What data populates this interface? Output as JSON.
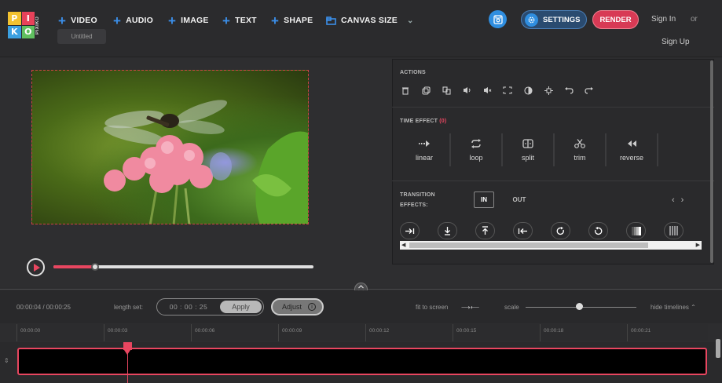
{
  "logo": {
    "letters": [
      "PI",
      "XI",
      "KO",
      "PIXIKO"
    ]
  },
  "menu": {
    "video": "VIDEO",
    "audio": "AUDIO",
    "image": "IMAGE",
    "text": "TEXT",
    "shape": "SHAPE",
    "canvas_size": "CANVAS SIZE"
  },
  "project": {
    "title": "Untitled"
  },
  "header": {
    "settings": "SETTINGS",
    "render": "RENDER",
    "sign_in": "Sign In",
    "or": "or",
    "sign_up": "Sign Up"
  },
  "player": {
    "progress": 0.16
  },
  "panel": {
    "actions_title": "ACTIONS",
    "time_effect_title": "TIME EFFECT",
    "time_effect_count": "(0)",
    "time_effects": [
      "linear",
      "loop",
      "split",
      "trim",
      "reverse"
    ],
    "transition_title_1": "TRANSITION",
    "transition_title_2": "EFFECTS:",
    "in": "IN",
    "out": "OUT"
  },
  "timeline": {
    "timecode": "00:00:04 / 00:00:25",
    "length_set_label": "length set:",
    "length_value": "00 : 00 : 25",
    "apply": "Apply",
    "adjust": "Adjust",
    "fit_to_screen": "fit to screen",
    "scale": "scale",
    "scale_value": 0.48,
    "hide_timelines": "hide timelines",
    "ticks": [
      "00:00:00",
      "00:00:03",
      "00:00:06",
      "00:00:09",
      "00:00:12",
      "00:00:15",
      "00:00:18",
      "00:00:21"
    ]
  },
  "colors": {
    "accent": "#e84660",
    "blue": "#2f8ee0"
  }
}
